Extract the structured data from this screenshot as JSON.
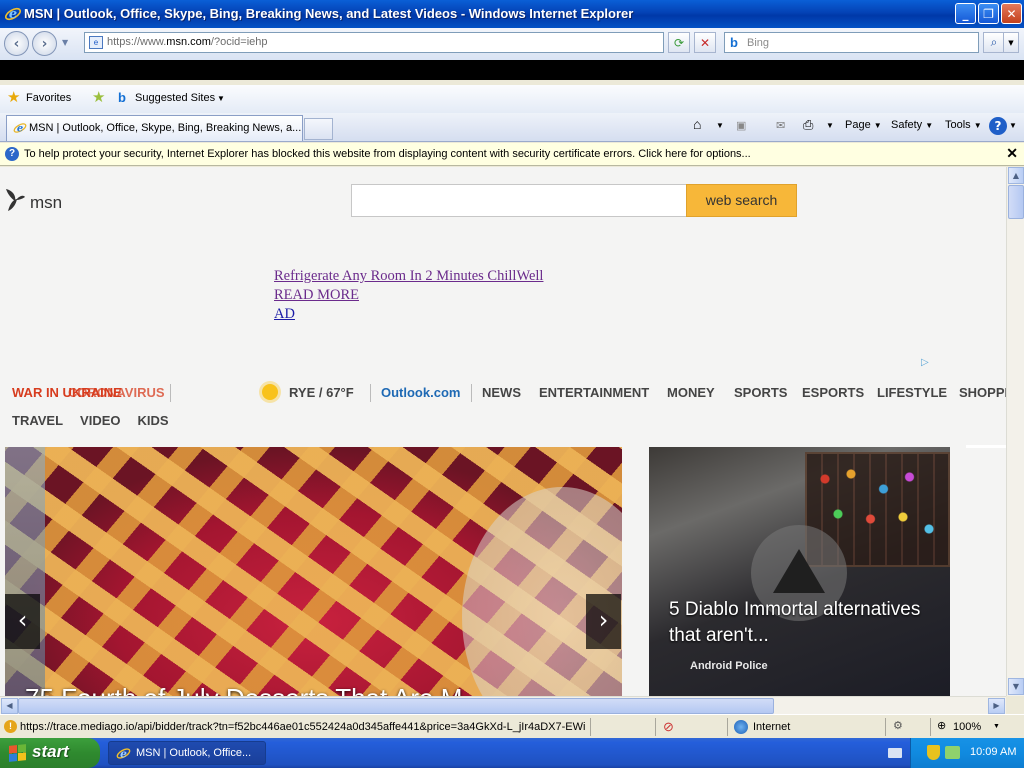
{
  "window": {
    "title": "MSN | Outlook, Office, Skype, Bing, Breaking News, and Latest Videos - Windows Internet Explorer",
    "minimize": "_",
    "maximize": "❐",
    "close": "✕"
  },
  "address": {
    "prefix": "https://www.",
    "domain": "msn.com",
    "suffix": "/?ocid=iehp",
    "search_placeholder": "Bing"
  },
  "favorites_bar": {
    "favorites_label": "Favorites",
    "suggested_label": "Suggested Sites"
  },
  "tab": {
    "label": "MSN | Outlook, Office, Skype, Bing, Breaking News, a..."
  },
  "command_bar": {
    "page": "Page",
    "safety": "Safety",
    "tools": "Tools",
    "help": "?"
  },
  "infobar": {
    "message": "To help protect your security, Internet Explorer has blocked this website from displaying content with security certificate errors. Click here for options..."
  },
  "msn": {
    "logo_text": "msn",
    "search_button": "web search",
    "ad_lines": [
      "Refrigerate Any Room In 2 Minutes ChillWell",
      "READ MORE",
      "AD"
    ],
    "breaking_a": "WAR IN UKRAINE",
    "breaking_b": "CORONAVIRUS",
    "weather": "RYE / 67°F",
    "outlook": "Outlook.com",
    "nav_row1": [
      "NEWS",
      "ENTERTAINMENT",
      "MONEY",
      "SPORTS",
      "ESPORTS",
      "LIFESTYLE",
      "SHOPPI"
    ],
    "nav_row2": [
      "TRAVEL",
      "VIDEO",
      "KIDS"
    ],
    "hero_caption": "75 Fourth of July Desserts That Are M",
    "card_title": "5 Diablo Immortal alternatives that aren't...",
    "card_source": "Android Police"
  },
  "statusbar": {
    "url": "https://trace.mediago.io/api/bidder/track?tn=f52bc446ae01c552424a0d345affe441&price=3a4GkXd-L_jIr4aDX7-EWi",
    "zone": "Internet",
    "zoom": "100%"
  },
  "taskbar": {
    "start": "start",
    "item": "MSN | Outlook, Office...",
    "clock": "10:09 AM"
  }
}
